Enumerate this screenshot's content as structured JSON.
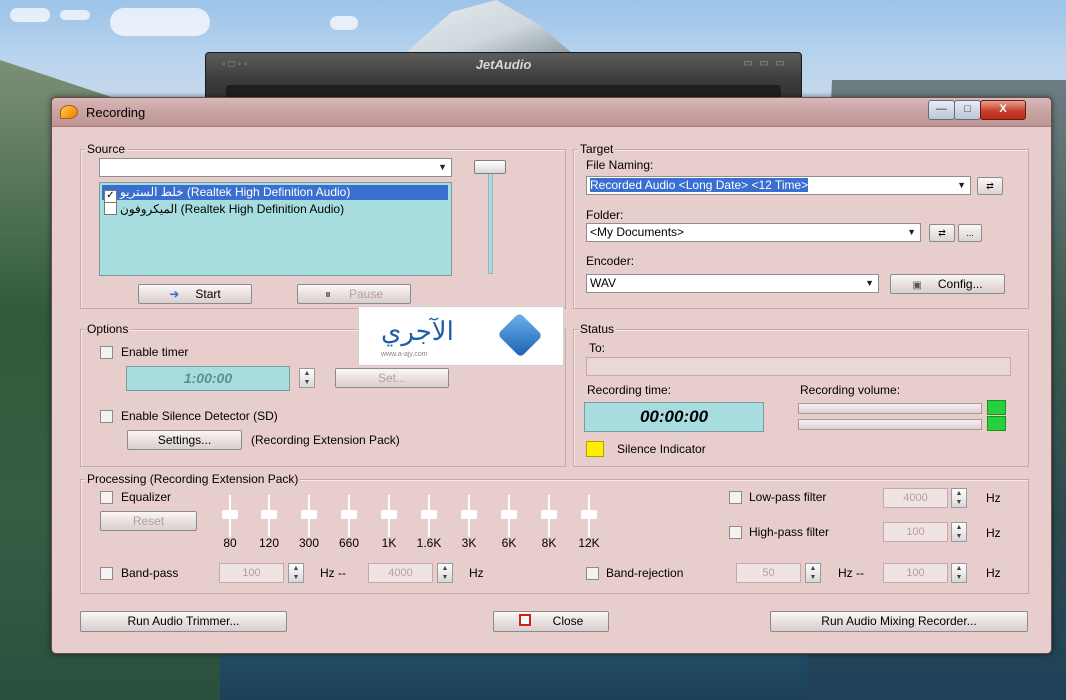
{
  "jetaudio": {
    "title": "JetAudio"
  },
  "dialog": {
    "title": "Recording",
    "window_buttons": {
      "minimize": "—",
      "maximize": "□",
      "close": "X"
    }
  },
  "source": {
    "label": "Source",
    "combo_value": "",
    "items": [
      {
        "label": "خلط الستريو (Realtek High Definition Audio)",
        "checked": true,
        "selected": true
      },
      {
        "label": "الميكروفون (Realtek High Definition Audio)",
        "checked": false,
        "selected": false
      }
    ],
    "start_label": "Start",
    "pause_label": "Pause"
  },
  "target": {
    "label": "Target",
    "file_naming_label": "File Naming:",
    "file_naming_value": "Recorded Audio <Long Date> <12 Time>",
    "folder_label": "Folder:",
    "folder_value": "<My Documents>",
    "browse_label": "...",
    "encoder_label": "Encoder:",
    "encoder_value": "WAV",
    "config_label": "Config..."
  },
  "options": {
    "label": "Options",
    "enable_timer": "Enable timer",
    "timer_value": "1:00:00",
    "set_label": "Set...",
    "enable_sd": "Enable Silence Detector (SD)",
    "settings_label": "Settings...",
    "pack_note": "(Recording Extension Pack)"
  },
  "status": {
    "label": "Status",
    "to_label": "To:",
    "to_value": "",
    "recording_time_label": "Recording time:",
    "recording_time": "00:00:00",
    "recording_volume_label": "Recording volume:",
    "silence_indicator": "Silence Indicator"
  },
  "processing": {
    "label": "Processing (Recording Extension Pack)",
    "equalizer": "Equalizer",
    "reset": "Reset",
    "bands": [
      "80",
      "120",
      "300",
      "660",
      "1K",
      "1.6K",
      "3K",
      "6K",
      "8K",
      "12K"
    ],
    "lowpass_label": "Low-pass filter",
    "lowpass_value": "4000",
    "highpass_label": "High-pass filter",
    "highpass_value": "100",
    "hz": "Hz",
    "hz_dash": "Hz --",
    "bandpass_label": "Band-pass",
    "bandpass_low": "100",
    "bandpass_high": "4000",
    "bandrejection_label": "Band-rejection",
    "bandrejection_low": "50",
    "bandrejection_high": "100"
  },
  "footer": {
    "run_trimmer": "Run Audio Trimmer...",
    "close": "Close",
    "run_mixing": "Run Audio Mixing Recorder..."
  },
  "watermark": {
    "text": "الآجري",
    "sub": "www.a-ajy.com"
  }
}
